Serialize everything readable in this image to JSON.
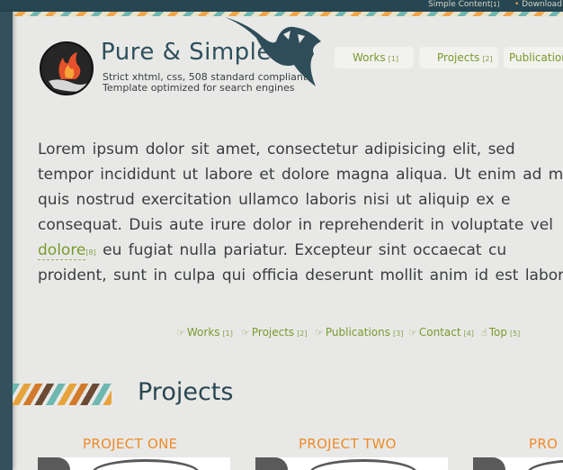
{
  "header": {
    "title": "Pure & Simple",
    "subtitle_line1": "Strict xhtml, css, 508 standard compliant",
    "subtitle_line2": "Template optimized for search engines",
    "topbar_left": "Simple Content",
    "topbar_left_num": "[1]",
    "topbar_right": "Download"
  },
  "nav": [
    {
      "label": "Works",
      "num": "[1]"
    },
    {
      "label": "Projects",
      "num": "[2]"
    },
    {
      "label": "Publications",
      "num": ""
    }
  ],
  "body": {
    "lines": [
      "Lorem ipsum dolor sit amet, consectetur adipisicing elit, sed",
      "tempor incididunt ut labore et dolore magna aliqua. Ut enim ad m",
      "quis nostrud exercitation ullamco laboris nisi ut aliquip ex e",
      "consequat. Duis aute irure dolor in reprehenderit in voluptate vel"
    ],
    "link_text": "dolore",
    "link_num": "[8]",
    "line5_rest": " eu fugiat nulla pariatur. Excepteur sint occaecat cu",
    "line6": "proident, sunt in culpa qui officia deserunt mollit anim id est laboru"
  },
  "footer_nav": [
    {
      "label": "Works",
      "num": "[1]"
    },
    {
      "label": "Projects",
      "num": "[2]"
    },
    {
      "label": "Publications",
      "num": "[3]"
    },
    {
      "label": "Contact",
      "num": "[4]"
    },
    {
      "label": "Top",
      "num": "[5]"
    }
  ],
  "section": {
    "title": "Projects"
  },
  "projects": [
    {
      "title": "PROJECT ONE"
    },
    {
      "title": "PROJECT TWO"
    },
    {
      "title": "PRO"
    }
  ],
  "colors": {
    "accent_green": "#7a9a2e",
    "accent_orange": "#ef8a2a",
    "dark_teal": "#2b4651"
  }
}
